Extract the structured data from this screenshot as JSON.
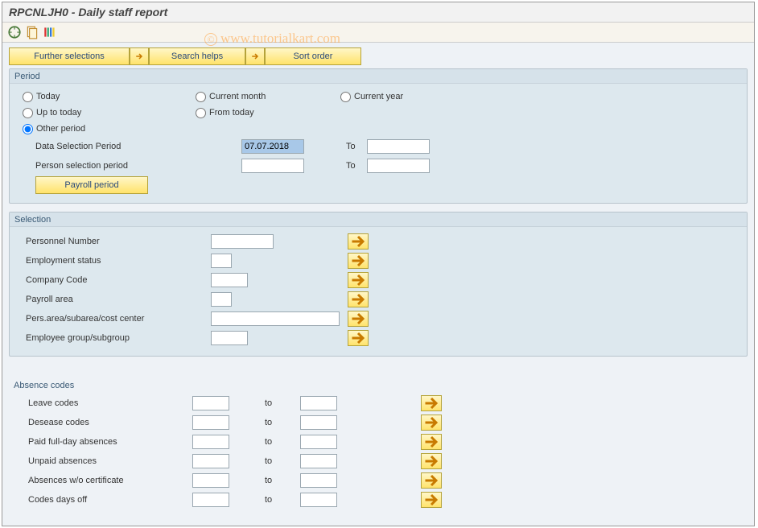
{
  "title": "RPCNLJH0 - Daily staff report",
  "watermark": "www.tutorialkart.com",
  "buttons": {
    "further_selections": "Further selections",
    "search_helps": "Search helps",
    "sort_order": "Sort order",
    "payroll_period": "Payroll period"
  },
  "period": {
    "title": "Period",
    "today": "Today",
    "current_month": "Current month",
    "current_year": "Current year",
    "up_to_today": "Up to today",
    "from_today": "From today",
    "other_period": "Other period",
    "data_selection_label": "Data Selection Period",
    "data_selection_from": "07.07.2018",
    "data_selection_to_label": "To",
    "data_selection_to": "",
    "person_selection_label": "Person selection period",
    "person_selection_from": "",
    "person_selection_to_label": "To",
    "person_selection_to": ""
  },
  "selection": {
    "title": "Selection",
    "personnel_number": "Personnel Number",
    "employment_status": "Employment status",
    "company_code": "Company Code",
    "payroll_area": "Payroll area",
    "pers_area": "Pers.area/subarea/cost center",
    "emp_group": "Employee group/subgroup"
  },
  "absence": {
    "title": "Absence codes",
    "to_label": "to",
    "rows": [
      {
        "label": "Leave codes"
      },
      {
        "label": "Desease codes"
      },
      {
        "label": "Paid full-day absences"
      },
      {
        "label": "Unpaid absences"
      },
      {
        "label": "Absences w/o certificate"
      },
      {
        "label": "Codes days off"
      }
    ]
  }
}
